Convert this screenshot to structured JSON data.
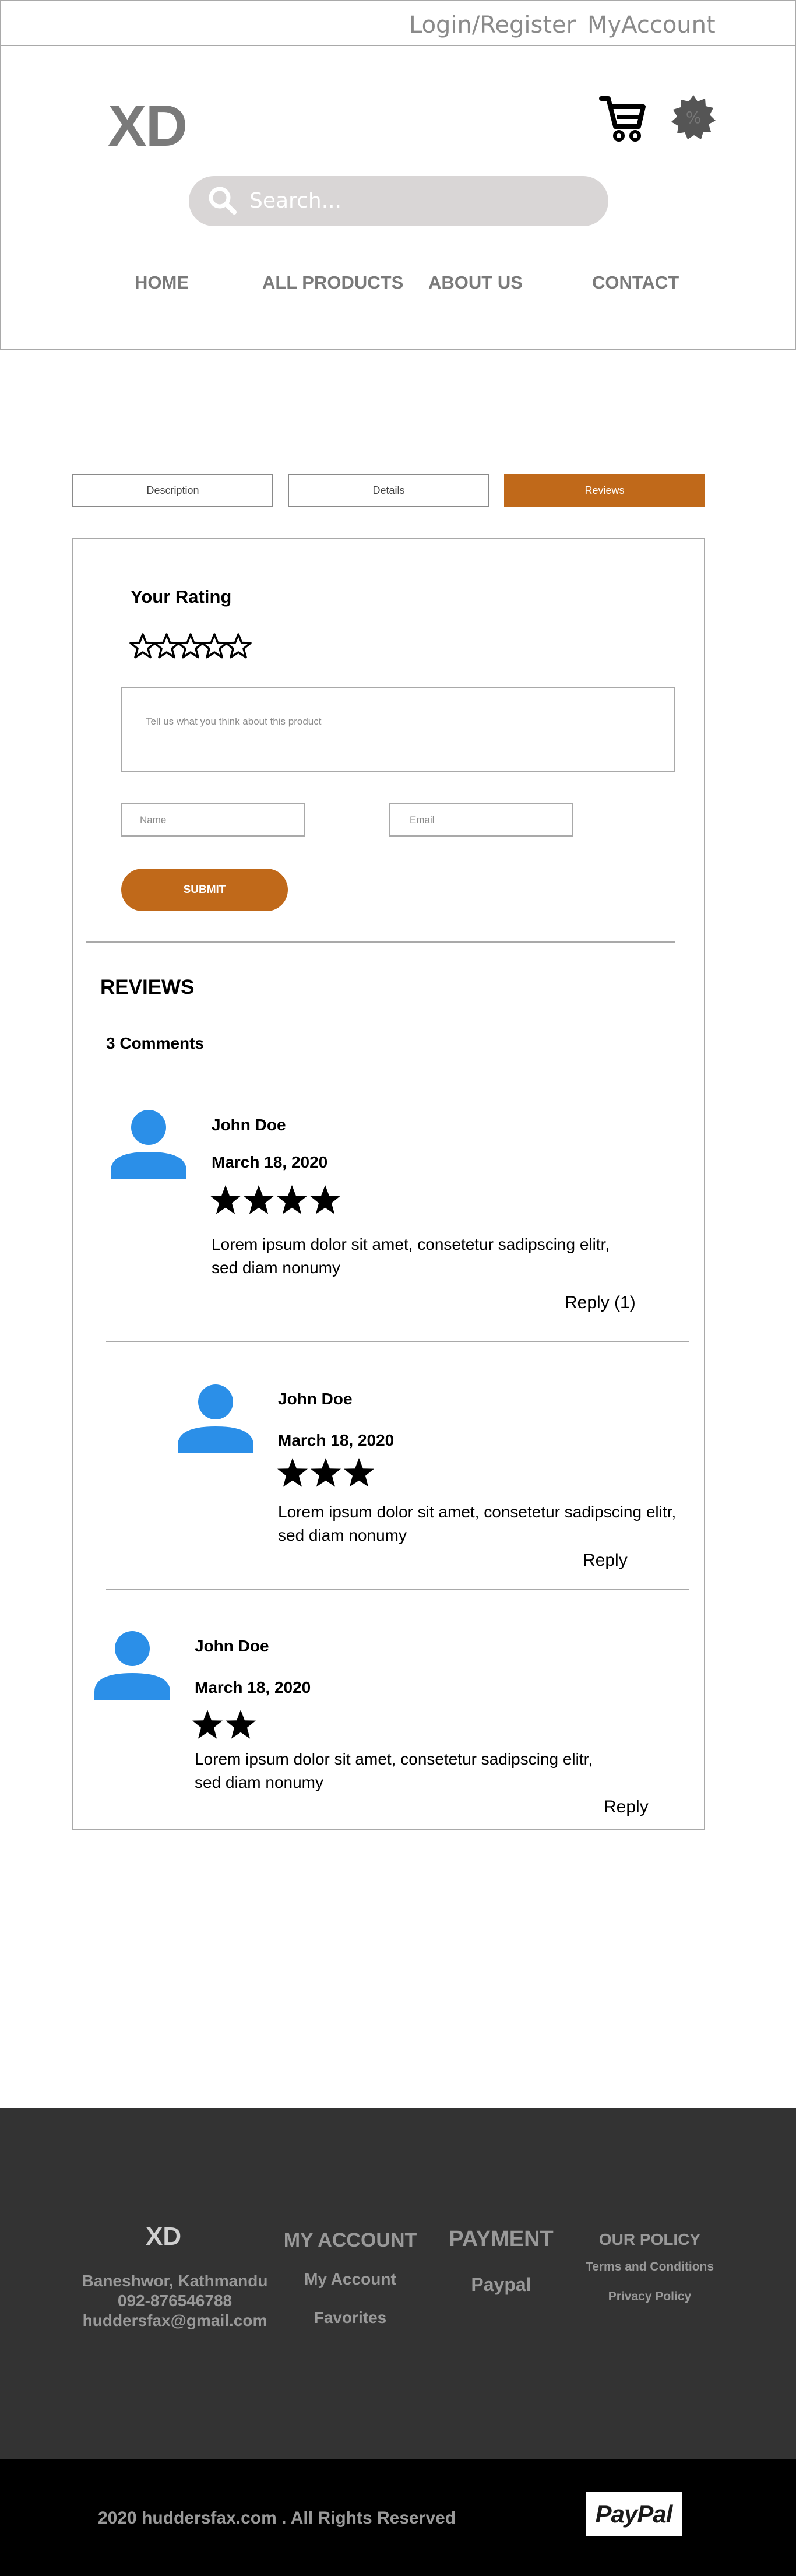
{
  "topbar": {
    "login_label": "Login/Register",
    "account_label": "MyAccount"
  },
  "header": {
    "logo": "XD",
    "cart_icon": "cart-icon",
    "badge_icon": "discount-badge-icon",
    "badge_text": "%"
  },
  "search": {
    "placeholder": "Search..."
  },
  "nav": {
    "home": "HOME",
    "all_products": "ALL PRODUCTS",
    "about_us": "ABOUT US",
    "contact": "CONTACT"
  },
  "tabs": [
    {
      "label": "Description",
      "active": false
    },
    {
      "label": "Details",
      "active": false
    },
    {
      "label": "Reviews",
      "active": true
    }
  ],
  "review_form": {
    "title": "Your Rating",
    "rating": 0,
    "rating_max": 5,
    "comment_placeholder": "Tell us what you think about this product",
    "name_placeholder": "Name",
    "email_placeholder": "Email",
    "submit_label": "SUBMIT"
  },
  "reviews": {
    "heading": "REVIEWS",
    "count_label": "3 Comments",
    "items": [
      {
        "name": "John Doe",
        "date": "March 18, 2020",
        "stars": 4,
        "text_line1": "Lorem ipsum dolor sit amet, consetetur sadipscing elitr,",
        "text_line2": "sed diam nonumy",
        "reply_label": "Reply (1)"
      },
      {
        "name": "John Doe",
        "date": "March 18, 2020",
        "stars": 3,
        "text_line1": "Lorem ipsum dolor sit amet, consetetur sadipscing elitr,",
        "text_line2": "sed diam nonumy",
        "reply_label": "Reply"
      },
      {
        "name": "John Doe",
        "date": "March 18, 2020",
        "stars": 2,
        "text_line1": "Lorem ipsum dolor sit amet, consetetur sadipscing elitr,",
        "text_line2": "sed diam nonumy",
        "reply_label": "Reply"
      }
    ]
  },
  "footer": {
    "logo": "XD",
    "address": "Baneshwor, Kathmandu",
    "phone": "092-876546788",
    "email": "huddersfax@gmail.com",
    "my_account_heading": "MY ACCOUNT",
    "my_account_link": "My Account",
    "favorites_link": "Favorites",
    "payment_heading": "PAYMENT",
    "paypal_link": "Paypal",
    "policy_heading": "OUR POLICY",
    "terms_link": "Terms and Conditions",
    "privacy_link": "Privacy Policy",
    "copyright": "2020 huddersfax.com . All Rights Reserved",
    "paypal_logo": "PayPal"
  },
  "colors": {
    "accent": "#c0691a",
    "avatar": "#2b8fe8",
    "footer_bg": "#333333",
    "bottom_bar": "#000000",
    "search_bg": "#d9d6d6"
  }
}
